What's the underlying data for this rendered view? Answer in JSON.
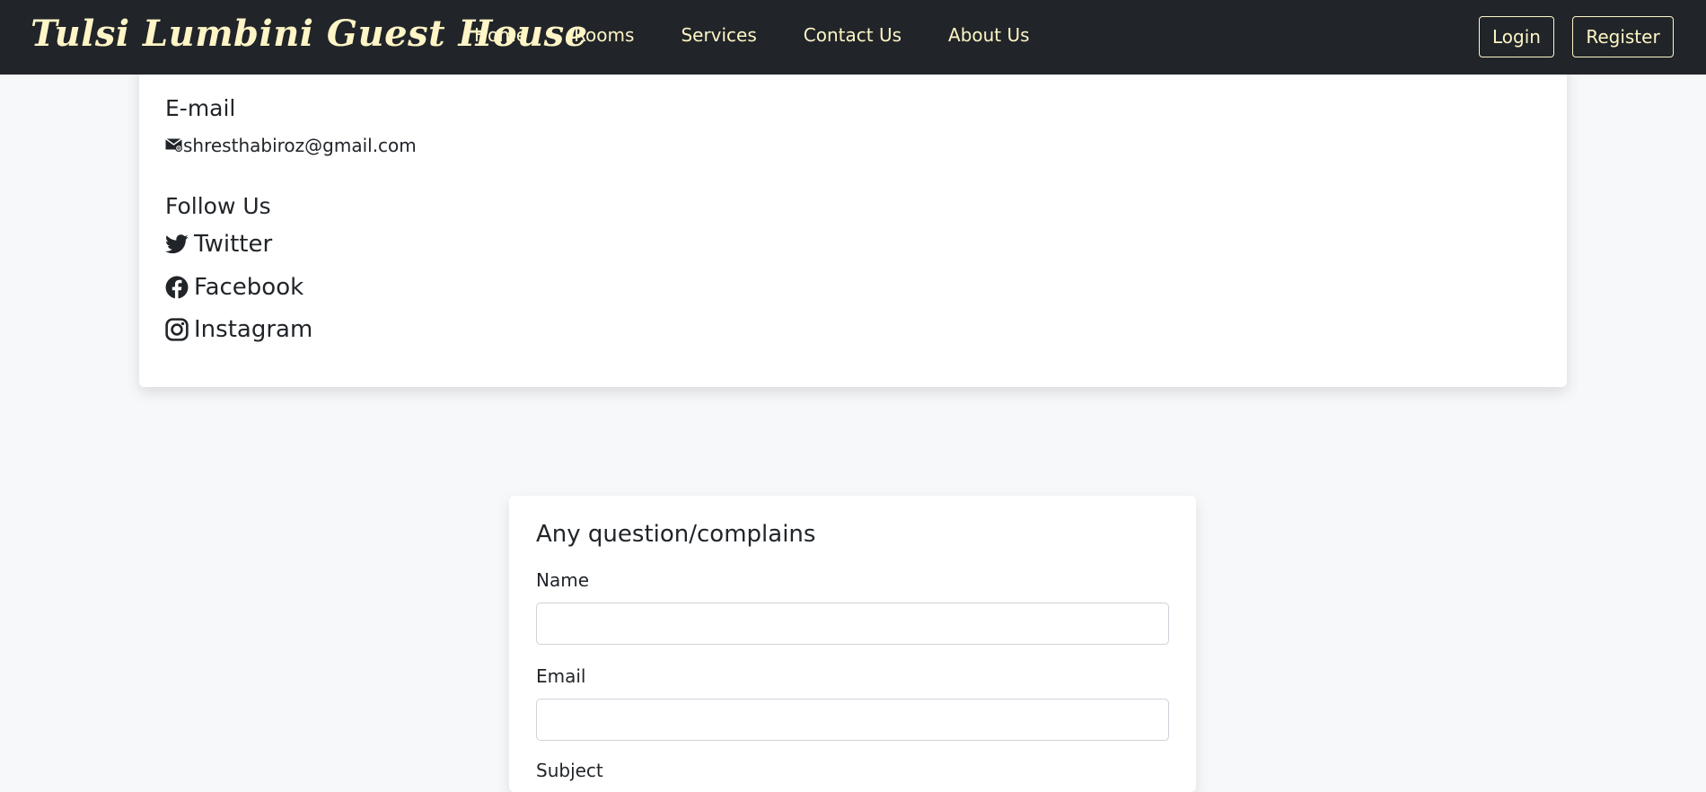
{
  "navbar": {
    "brand": "Tulsi Lumbini Guest House",
    "links": [
      "Home",
      "Rooms",
      "Services",
      "Contact Us",
      "About Us"
    ],
    "login_label": "Login",
    "register_label": "Register"
  },
  "contact": {
    "email_heading": "E-mail",
    "email_address": "shresthabiroz@gmail.com",
    "follow_heading": "Follow Us",
    "socials": [
      "Twitter",
      "Facebook",
      "Instagram"
    ]
  },
  "form": {
    "title": "Any question/complains",
    "name_label": "Name",
    "email_label": "Email",
    "subject_label": "Subject",
    "name_value": "",
    "email_value": ""
  },
  "colors": {
    "navbar_bg": "#212529",
    "accent_text": "#fff5c6",
    "page_bg": "#f7f8fa"
  }
}
